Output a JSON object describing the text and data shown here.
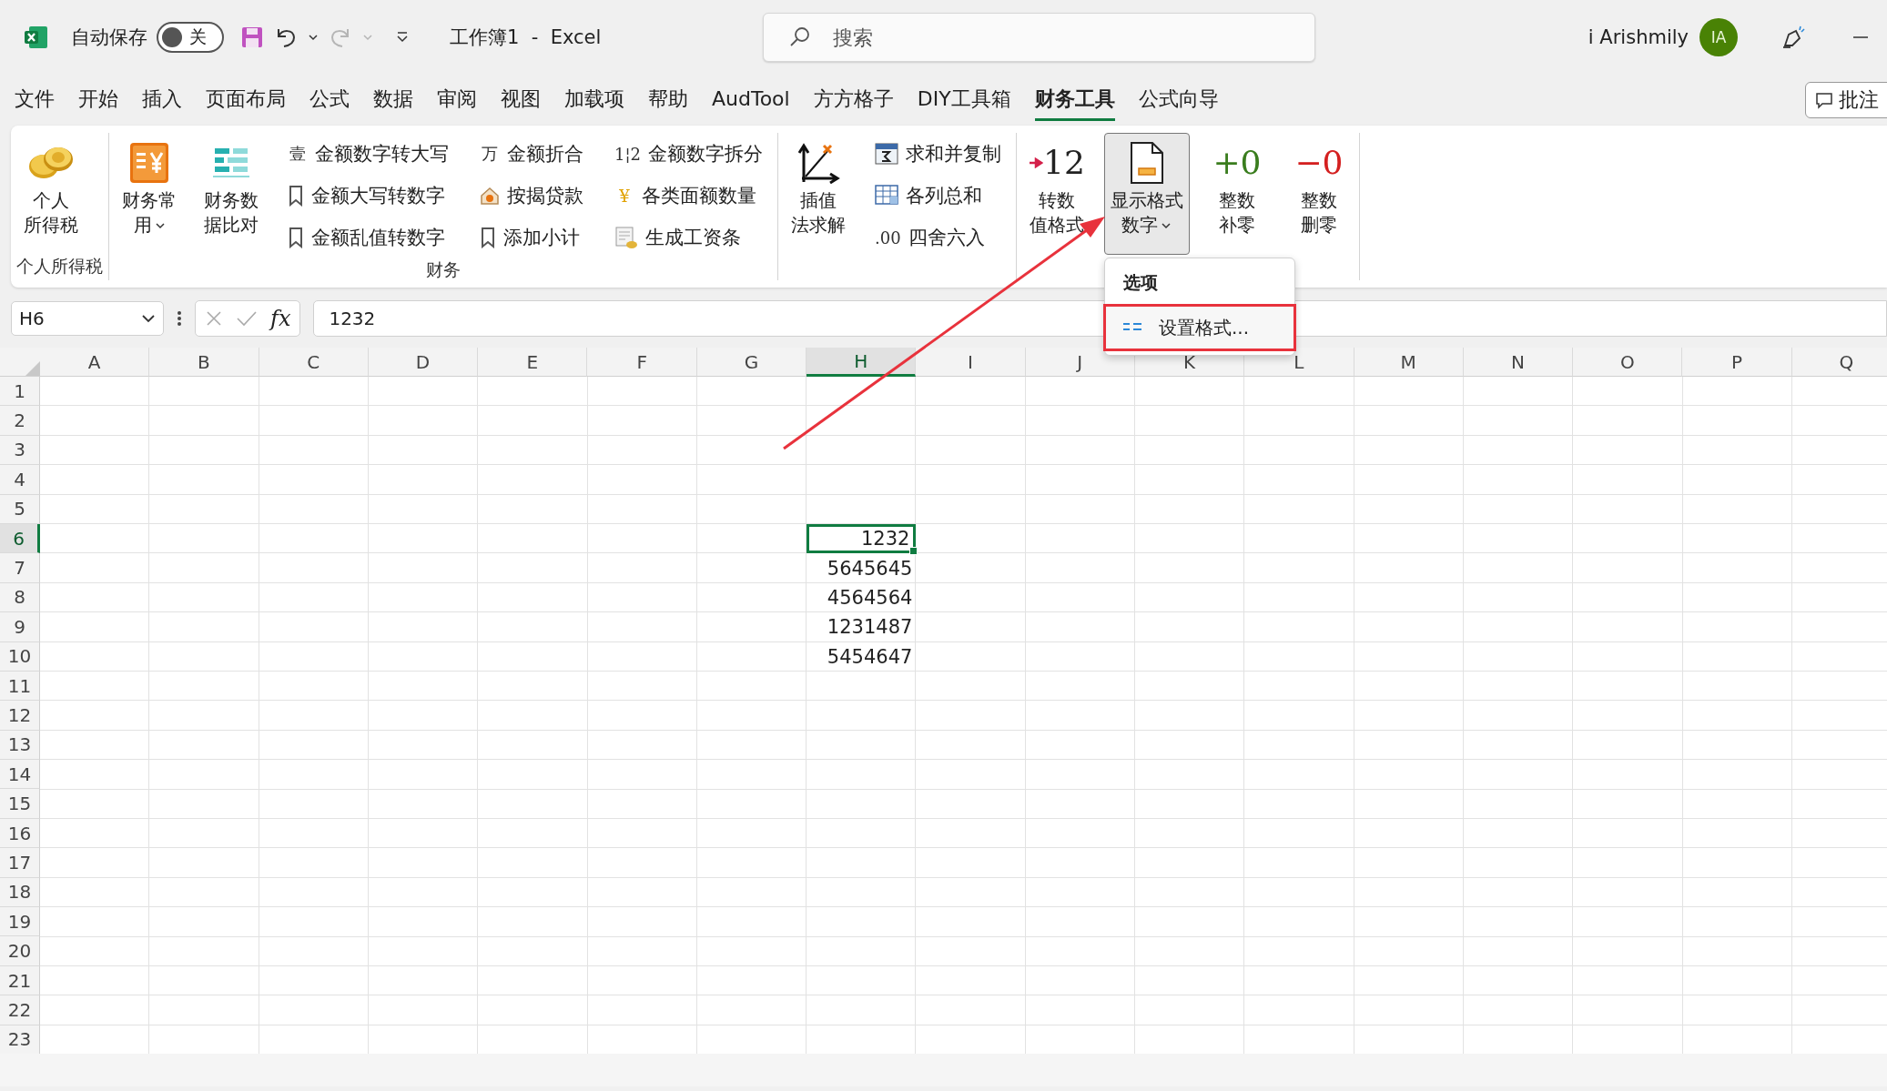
{
  "title_bar": {
    "autosave_label": "自动保存",
    "autosave_toggle": {
      "on": false,
      "label": "关"
    },
    "document_title": "工作簿1  -  Excel",
    "search": {
      "placeholder": "搜索"
    },
    "user_name": "i Arishmily",
    "avatar_initials": "IA"
  },
  "menu_tabs": [
    {
      "label": "文件",
      "selected": false
    },
    {
      "label": "开始",
      "selected": false
    },
    {
      "label": "插入",
      "selected": false
    },
    {
      "label": "页面布局",
      "selected": false
    },
    {
      "label": "公式",
      "selected": false
    },
    {
      "label": "数据",
      "selected": false
    },
    {
      "label": "审阅",
      "selected": false
    },
    {
      "label": "视图",
      "selected": false
    },
    {
      "label": "加载项",
      "selected": false
    },
    {
      "label": "帮助",
      "selected": false
    },
    {
      "label": "AudTool",
      "selected": false
    },
    {
      "label": "方方格子",
      "selected": false
    },
    {
      "label": "DIY工具箱",
      "selected": false
    },
    {
      "label": "财务工具",
      "selected": true
    },
    {
      "label": "公式向导",
      "selected": false
    }
  ],
  "comment_button": "批注",
  "ribbon": {
    "groups": [
      {
        "label": "个人所得税",
        "items": [
          {
            "kind": "large",
            "lines": [
              "个人",
              "所得税"
            ],
            "dropdown": false,
            "pressed": false
          }
        ]
      },
      {
        "label": "财务",
        "items": [
          {
            "kind": "large",
            "lines": [
              "财务常",
              "用"
            ],
            "dropdown": true,
            "pressed": false
          },
          {
            "kind": "large",
            "lines": [
              "财务数",
              "据比对"
            ],
            "dropdown": false,
            "pressed": false
          },
          {
            "kind": "column",
            "entries": [
              {
                "label": "金额数字转大写",
                "glyph": "壹"
              },
              {
                "label": "金额大写转数字"
              },
              {
                "label": "金额乱值转数字"
              }
            ]
          },
          {
            "kind": "column",
            "entries": [
              {
                "label": "金额折合",
                "glyph": "万"
              },
              {
                "label": "按揭贷款"
              },
              {
                "label": "添加小计"
              }
            ]
          },
          {
            "kind": "column",
            "entries": [
              {
                "label": "金额数字拆分",
                "glyph": "1¦2"
              },
              {
                "label": "各类面额数量",
                "glyph": "¥",
                "color": "#e0a100"
              },
              {
                "label": "生成工资条"
              }
            ]
          }
        ]
      },
      {
        "items": [
          {
            "kind": "large",
            "lines": [
              "插值",
              "法求解"
            ],
            "dropdown": false,
            "pressed": false
          },
          {
            "kind": "column",
            "entries": [
              {
                "label": "求和并复制"
              },
              {
                "label": "各列总和"
              },
              {
                "label": "四舍六入",
                "glyph": ".00"
              }
            ]
          }
        ]
      },
      {
        "items": [
          {
            "kind": "large",
            "lines": [
              "转数",
              "值格式"
            ],
            "glyph": {
              "text": "12",
              "color": "#222222",
              "arrow": true
            },
            "dropdown": false,
            "pressed": false
          },
          {
            "kind": "large",
            "lines": [
              "显示格式",
              "数字"
            ],
            "dropdown": true,
            "pressed": true,
            "menu": {
              "header": "选项",
              "items": [
                {
                  "label": "设置格式...",
                  "highlighted": true
                }
              ]
            }
          },
          {
            "kind": "large",
            "lines": [
              "整数",
              "补零"
            ],
            "glyph": {
              "text": "+0",
              "color": "#3a7d1e",
              "arrow": false
            },
            "dropdown": false,
            "pressed": false
          },
          {
            "kind": "large",
            "lines": [
              "整数",
              "删零"
            ],
            "glyph": {
              "text": "−0",
              "color": "#d42020",
              "arrow": false
            },
            "dropdown": false,
            "pressed": false
          }
        ]
      }
    ]
  },
  "formula_bar": {
    "name_box": "H6",
    "fx": "fx",
    "formula": "1232"
  },
  "grid": {
    "columns": [
      {
        "label": "A",
        "selected": false
      },
      {
        "label": "B",
        "selected": false
      },
      {
        "label": "C",
        "selected": false
      },
      {
        "label": "D",
        "selected": false
      },
      {
        "label": "E",
        "selected": false
      },
      {
        "label": "F",
        "selected": false
      },
      {
        "label": "G",
        "selected": false
      },
      {
        "label": "H",
        "selected": true
      },
      {
        "label": "I",
        "selected": false
      },
      {
        "label": "J",
        "selected": false
      },
      {
        "label": "K",
        "selected": false
      },
      {
        "label": "L",
        "selected": false
      },
      {
        "label": "M",
        "selected": false
      },
      {
        "label": "N",
        "selected": false
      },
      {
        "label": "O",
        "selected": false
      },
      {
        "label": "P",
        "selected": false
      },
      {
        "label": "Q",
        "selected": false
      }
    ],
    "rows": [
      {
        "label": "1",
        "selected": false,
        "cells": []
      },
      {
        "label": "2",
        "selected": false,
        "cells": []
      },
      {
        "label": "3",
        "selected": false,
        "cells": []
      },
      {
        "label": "4",
        "selected": false,
        "cells": []
      },
      {
        "label": "5",
        "selected": false,
        "cells": []
      },
      {
        "label": "6",
        "selected": true,
        "cells": [
          {},
          {},
          {},
          {},
          {},
          {},
          {},
          {
            "value": "1232",
            "active": true
          }
        ]
      },
      {
        "label": "7",
        "selected": false,
        "cells": [
          {},
          {},
          {},
          {},
          {},
          {},
          {},
          {
            "value": "5645645",
            "active": false
          }
        ]
      },
      {
        "label": "8",
        "selected": false,
        "cells": [
          {},
          {},
          {},
          {},
          {},
          {},
          {},
          {
            "value": "4564564",
            "active": false
          }
        ]
      },
      {
        "label": "9",
        "selected": false,
        "cells": [
          {},
          {},
          {},
          {},
          {},
          {},
          {},
          {
            "value": "1231487",
            "active": false
          }
        ]
      },
      {
        "label": "10",
        "selected": false,
        "cells": [
          {},
          {},
          {},
          {},
          {},
          {},
          {},
          {
            "value": "5454647",
            "active": false
          }
        ]
      },
      {
        "label": "11",
        "selected": false,
        "cells": []
      },
      {
        "label": "12",
        "selected": false,
        "cells": []
      },
      {
        "label": "13",
        "selected": false,
        "cells": []
      },
      {
        "label": "14",
        "selected": false,
        "cells": []
      },
      {
        "label": "15",
        "selected": false,
        "cells": []
      },
      {
        "label": "16",
        "selected": false,
        "cells": []
      },
      {
        "label": "17",
        "selected": false,
        "cells": []
      },
      {
        "label": "18",
        "selected": false,
        "cells": []
      },
      {
        "label": "19",
        "selected": false,
        "cells": []
      },
      {
        "label": "20",
        "selected": false,
        "cells": []
      },
      {
        "label": "21",
        "selected": false,
        "cells": []
      },
      {
        "label": "22",
        "selected": false,
        "cells": []
      },
      {
        "label": "23",
        "selected": false,
        "cells": []
      }
    ]
  },
  "annotations": [
    {
      "kind": "arrow"
    }
  ]
}
